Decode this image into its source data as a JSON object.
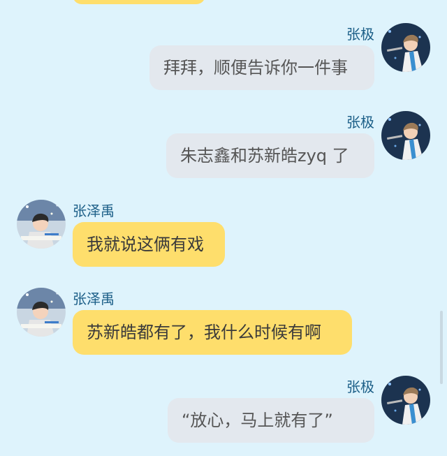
{
  "messages": [
    {
      "side": "right",
      "sender": "张极",
      "text": "拜拜，顺便告诉你一件事",
      "avatar": "avatar-zhangji"
    },
    {
      "side": "right",
      "sender": "张极",
      "text": "朱志鑫和苏新皓zyq 了",
      "avatar": "avatar-zhangji"
    },
    {
      "side": "left",
      "sender": "张泽禹",
      "text": "我就说这俩有戏",
      "avatar": "avatar-zhangzeyu"
    },
    {
      "side": "left",
      "sender": "张泽禹",
      "text": "苏新皓都有了，我什么时候有啊",
      "avatar": "avatar-zhangzeyu"
    },
    {
      "side": "right",
      "sender": "张极",
      "text": "“放心，马上就有了”",
      "avatar": "avatar-zhangji"
    }
  ],
  "colors": {
    "background": "#def3fc",
    "bubble_left": "#fede6c",
    "bubble_right": "#e3e8ee",
    "name_text": "#1b5e87"
  }
}
